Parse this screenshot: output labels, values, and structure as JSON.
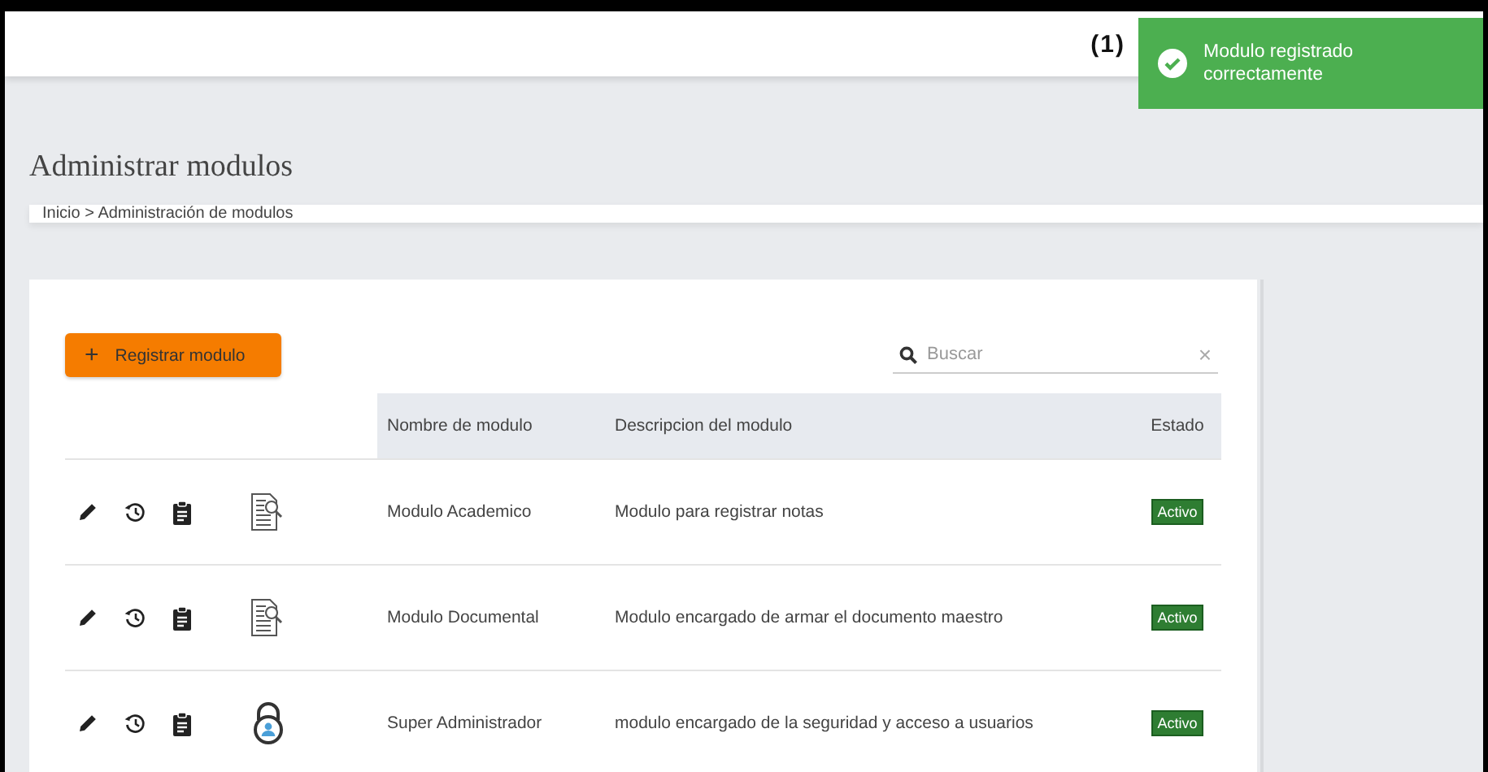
{
  "header": {
    "annotation": "(1)"
  },
  "toast": {
    "message": "Modulo registrado correctamente"
  },
  "page_title": "Administrar modulos",
  "breadcrumb": "Inicio > Administración de modulos",
  "register_button": {
    "label": "Registrar modulo",
    "icon": "+"
  },
  "search": {
    "placeholder": "Buscar",
    "clear": "×"
  },
  "table": {
    "columns": [
      "Nombre de modulo",
      "Descripcion del modulo",
      "Estado"
    ],
    "rows": [
      {
        "kind": "document",
        "name": "Modulo Academico",
        "description": "Modulo para registrar notas",
        "status": "Activo"
      },
      {
        "kind": "document",
        "name": "Modulo Documental",
        "description": "Modulo encargado de armar el documento maestro",
        "status": "Activo"
      },
      {
        "kind": "lock",
        "name": "Super Administrador",
        "description": "modulo encargado de la seguridad y acceso a usuarios",
        "status": "Activo"
      }
    ]
  }
}
